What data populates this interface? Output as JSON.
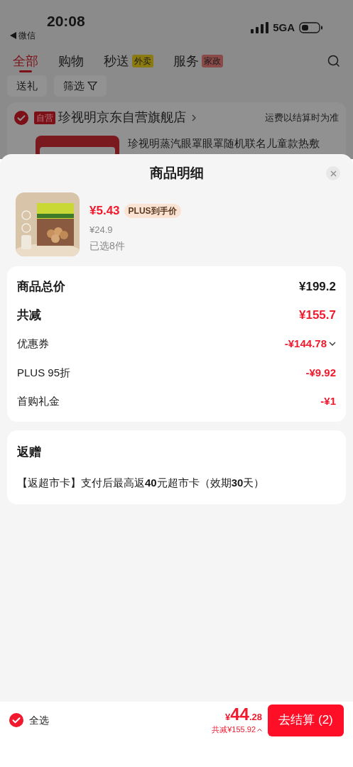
{
  "status_bar": {
    "time": "20:08",
    "back_app": "微信",
    "network": "5GA"
  },
  "tabs": [
    {
      "label": "全部",
      "selected": true
    },
    {
      "label": "购物",
      "selected": false
    },
    {
      "label": "秒送",
      "selected": false,
      "badge": "外卖",
      "color": "#8a7a10"
    },
    {
      "label": "服务",
      "selected": false,
      "badge": "家政",
      "color": "#8a4a48"
    }
  ],
  "filters": [
    {
      "label": "送礼",
      "kind": "plain"
    },
    {
      "label": "筛选",
      "kind": "filter"
    }
  ],
  "store": {
    "checked": true,
    "tag": "自营",
    "name": "珍视明京东自营旗舰店",
    "shipping_note": "运费以结算时为准"
  },
  "background_product": {
    "title": "珍视明蒸汽眼罩眼罩随机联名儿童款热敷"
  },
  "sheet": {
    "title": "商品明细",
    "item": {
      "price": "¥5.43",
      "badge": "PLUS到手价",
      "original_price": "¥24.9",
      "quantity": "已选8件"
    },
    "summary": [
      {
        "label": "商品总价",
        "value": "¥199.2",
        "kind": "total"
      },
      {
        "label": "共减",
        "value": "¥155.7",
        "kind": "discount_total"
      },
      {
        "label": "优惠券",
        "value": "-¥144.78",
        "kind": "dropdown"
      },
      {
        "label": "PLUS 95折",
        "value": "-¥9.92",
        "kind": "line"
      },
      {
        "label": "首购礼金",
        "value": "-¥1",
        "kind": "line"
      }
    ],
    "gift": {
      "title": "返赠",
      "text": "【返超市卡】支付后最高返**40**元超市卡（效期**30**天）"
    }
  },
  "bottom_bar": {
    "select_all": {
      "label": "全选",
      "checked": true
    },
    "currency": "¥",
    "total_integer": "44",
    "total_decimal": ".28",
    "savings": "共减¥155.92",
    "checkout": "去结算 (2)"
  }
}
